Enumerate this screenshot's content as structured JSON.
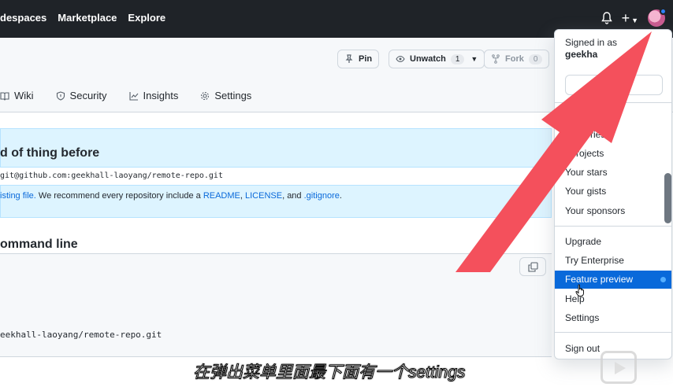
{
  "topnav": {
    "items": [
      "despaces",
      "Marketplace",
      "Explore"
    ]
  },
  "repo_actions": {
    "pin": "Pin",
    "unwatch": "Unwatch",
    "unwatch_count": "1",
    "fork": "Fork",
    "fork_count": "0"
  },
  "tabs": [
    "Wiki",
    "Security",
    "Insights",
    "Settings"
  ],
  "quick_setup": {
    "title": "d of thing before",
    "clone_url": "git@github.com:geekhall-laoyang/remote-repo.git",
    "recommend_prefix": "isting file.",
    "recommend_text": " We recommend every repository include a ",
    "readme": "README",
    "comma": ", ",
    "license": "LICENSE",
    "and": ", and ",
    "gitignore": ".gitignore",
    "period": "."
  },
  "command_line": {
    "title": "ommand line",
    "remote": "eekhall-laoyang/remote-repo.git"
  },
  "dropdown": {
    "signed_in_as": "Signed in as",
    "username": "geekha",
    "items": [
      "positories",
      "r projects",
      "Your stars",
      "Your gists",
      "Your sponsors",
      "Upgrade",
      "Try Enterprise",
      "Feature preview",
      "Help",
      "Settings",
      "Sign out"
    ]
  },
  "subtitle": "在弹出菜单里面最下面有一个settings",
  "colors": {
    "header_bg": "#1f2328",
    "accent": "#0969da",
    "arrow": "#f4505c",
    "setup_bg": "#ddf4ff"
  }
}
